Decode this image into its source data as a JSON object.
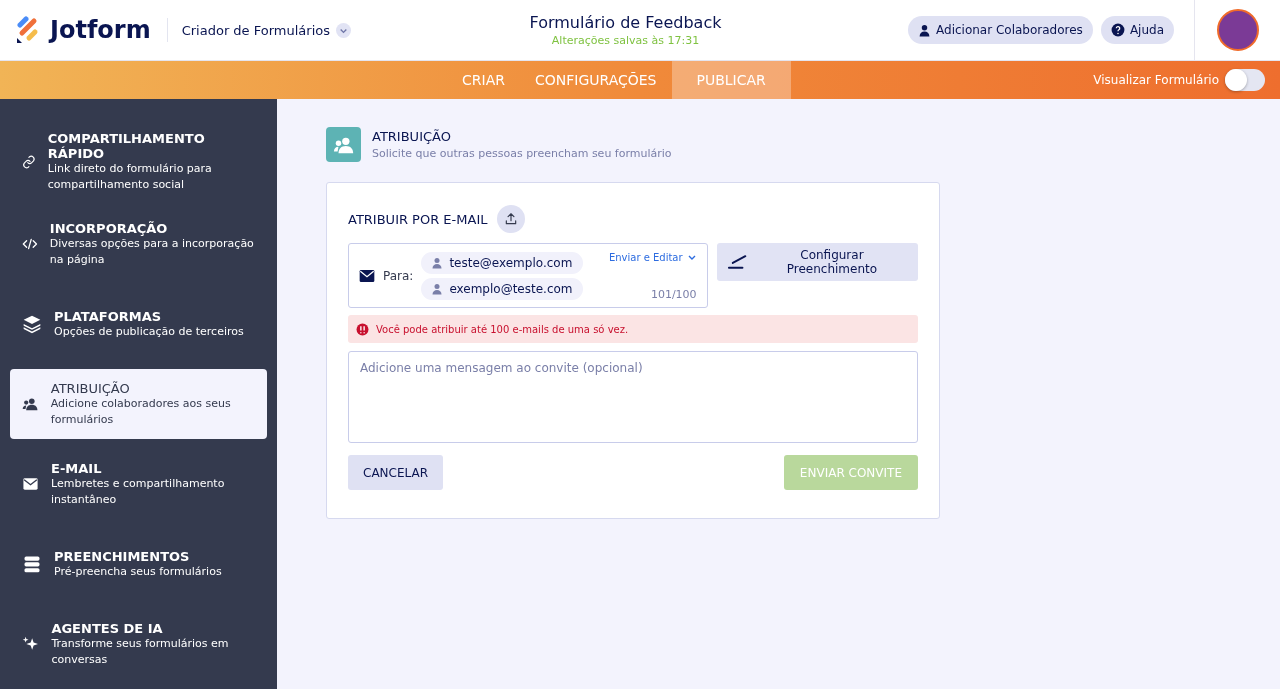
{
  "header": {
    "logo": "Jotform",
    "app_menu": "Criador de Formulários",
    "title": "Formulário de Feedback",
    "save_status": "Alterações salvas às 17:31",
    "buttons": [
      {
        "label": "Adicionar Colaboradores",
        "kind": "user"
      },
      {
        "label": "Ajuda",
        "kind": "help"
      }
    ]
  },
  "nav": {
    "tabs": [
      {
        "label": "CRIAR",
        "selected": false
      },
      {
        "label": "CONFIGURAÇÕES",
        "selected": false
      },
      {
        "label": "PUBLICAR",
        "selected": true
      }
    ],
    "preview": {
      "label": "Visualizar Formulário",
      "on": false
    }
  },
  "sidebar": {
    "items": [
      {
        "kind": "link",
        "title": "COMPARTILHAMENTO RÁPIDO",
        "subtitle": "Link direto do formulário para compartilhamento social",
        "selected": false
      },
      {
        "kind": "code",
        "title": "INCORPORAÇÃO",
        "subtitle": "Diversas opções para a incorporação na página",
        "selected": false
      },
      {
        "kind": "layers",
        "title": "PLATAFORMAS",
        "subtitle": "Opções de publicação de terceiros",
        "selected": false
      },
      {
        "kind": "people",
        "title": "ATRIBUIÇÃO",
        "subtitle": "Adicione colaboradores aos seus formulários",
        "selected": true
      },
      {
        "kind": "mail",
        "title": "E-MAIL",
        "subtitle": "Lembretes e compartilhamento instantâneo",
        "selected": false
      },
      {
        "kind": "stack",
        "title": "PREENCHIMENTOS",
        "subtitle": "Pré-preencha seus formulários",
        "selected": false
      },
      {
        "kind": "sparkle",
        "title": "AGENTES DE IA",
        "subtitle": "Transforme seus formulários em conversas",
        "selected": false
      }
    ]
  },
  "section": {
    "title": "ATRIBUIÇÃO",
    "subtitle": "Solicite que outras pessoas preencham seu formulário"
  },
  "assign": {
    "title": "ATRIBUIR POR E-MAIL",
    "to_label": "Para:",
    "recipients": [
      "teste@exemplo.com",
      "exemplo@teste.com"
    ],
    "mode": "Enviar e Editar",
    "count": "101/100",
    "prefill_button": "Configurar Preenchimento",
    "error": "Você pode atribuir até 100 e-mails de uma só vez.",
    "message_placeholder": "Adicione uma mensagem ao convite (opcional)",
    "cancel": "CANCELAR",
    "send": {
      "label": "ENVIAR CONVITE",
      "disabled": true
    }
  }
}
